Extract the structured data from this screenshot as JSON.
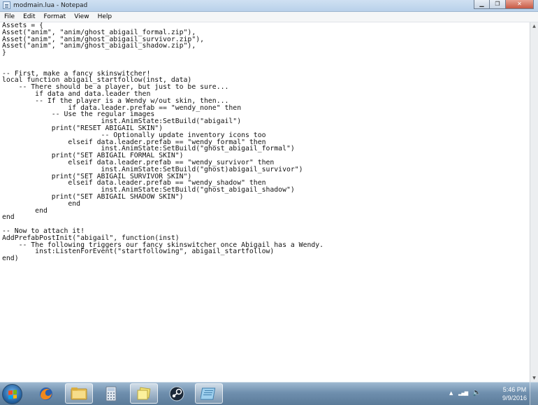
{
  "window": {
    "title": "modmain.lua - Notepad",
    "minimize_glyph": "▁",
    "maximize_glyph": "❐",
    "close_glyph": "✕"
  },
  "menu": [
    "File",
    "Edit",
    "Format",
    "View",
    "Help"
  ],
  "editor": {
    "lines": [
      "Assets = {",
      "Asset(\"anim\", \"anim/ghost_abigail_formal.zip\"),",
      "Asset(\"anim\", \"anim/ghost_abigail_survivor.zip\"),",
      "Asset(\"anim\", \"anim/ghost_abigail_shadow.zip\"),",
      "}",
      "",
      "",
      "-- First, make a fancy skinswitcher!",
      "local function abigail_startfollow(inst, data)",
      "    -- There should be a player, but just to be sure...",
      "        if data and data.leader then",
      "        -- If the player is a Wendy w/out skin, then...",
      "                if data.leader.prefab == \"wendy_none\" then",
      "            -- Use the regular images",
      "                        inst.AnimState:SetBuild(\"abigail\")",
      "            print(\"RESET ABIGAIL SKIN\")",
      "                        -- Optionally update inventory icons too",
      "                elseif data.leader.prefab == \"wendy_formal\" then",
      "                        inst.AnimState:SetBuild(\"ghost_abigail_formal\")",
      "            print(\"SET ABIGAIL FORMAL SKIN\")",
      "                elseif data.leader.prefab == \"wendy_survivor\" then",
      "                        inst.AnimState:SetBuild(\"ghost)abigail_survivor\")",
      "            print(\"SET ABIGAIL SURVIVOR SKIN\")",
      "                elseif data.leader.prefab == \"wendy_shadow\" then",
      "                        inst.AnimState:SetBuild(\"ghost_abigail_shadow\")",
      "            print(\"SET ABIGAIL SHADOW SKIN\")",
      "                end",
      "        end",
      "end",
      "",
      "-- Now to attach it!",
      "AddPrefabPostInit(\"abigail\", function(inst)",
      "    -- The following triggers our fancy skinswitcher once Abigail has a Wendy.",
      "        inst:ListenForEvent(\"startfollowing\", abigail_startfollow)",
      "end)"
    ]
  },
  "taskbar": {
    "apps": [
      {
        "name": "firefox-icon",
        "active": false
      },
      {
        "name": "file-explorer-icon",
        "active": true
      },
      {
        "name": "calculator-icon",
        "active": false
      },
      {
        "name": "sticky-notes-icon",
        "active": true
      },
      {
        "name": "steam-icon",
        "active": false
      },
      {
        "name": "notepad-icon",
        "active": true
      }
    ],
    "tray": {
      "show_hidden_glyph": "▲",
      "signal_glyph": "▂▄▆",
      "volume_glyph": "🔈"
    },
    "clock": {
      "time": "5:46 PM",
      "date": "9/9/2016"
    }
  },
  "colors": {
    "titlebar": "#c4d8ee",
    "taskbar": "#6f8fae",
    "text": "#111111"
  }
}
